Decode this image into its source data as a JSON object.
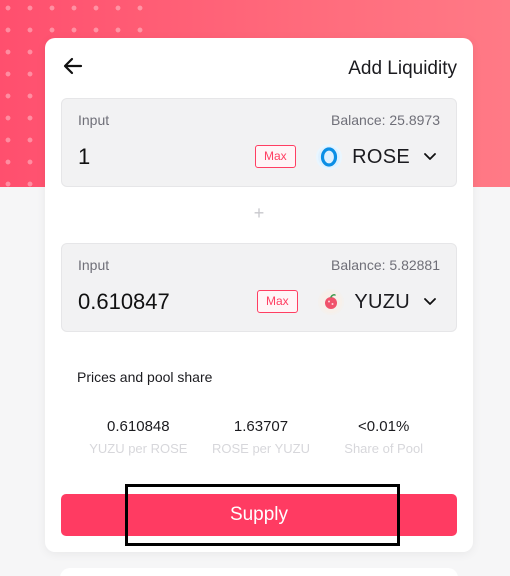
{
  "header": {
    "title": "Add Liquidity",
    "back_icon": "arrow-left-icon"
  },
  "colors": {
    "accent": "#ff3b62",
    "hero": "#ff5c74"
  },
  "input_a": {
    "label": "Input",
    "balance": "Balance: 25.8973",
    "amount": "1",
    "max_label": "Max",
    "token": "ROSE",
    "token_icon": "rose-token-icon"
  },
  "input_b": {
    "label": "Input",
    "balance": "Balance: 5.82881",
    "amount": "0.610847",
    "max_label": "Max",
    "token": "YUZU",
    "token_icon": "yuzu-token-icon"
  },
  "plus_symbol": "+",
  "prices": {
    "title": "Prices and pool share",
    "items": [
      {
        "value": "0.610848",
        "label": "YUZU per ROSE"
      },
      {
        "value": "1.63707",
        "label": "ROSE per YUZU"
      },
      {
        "value": "<0.01%",
        "label": "Share of Pool"
      }
    ]
  },
  "supply_label": "Supply"
}
